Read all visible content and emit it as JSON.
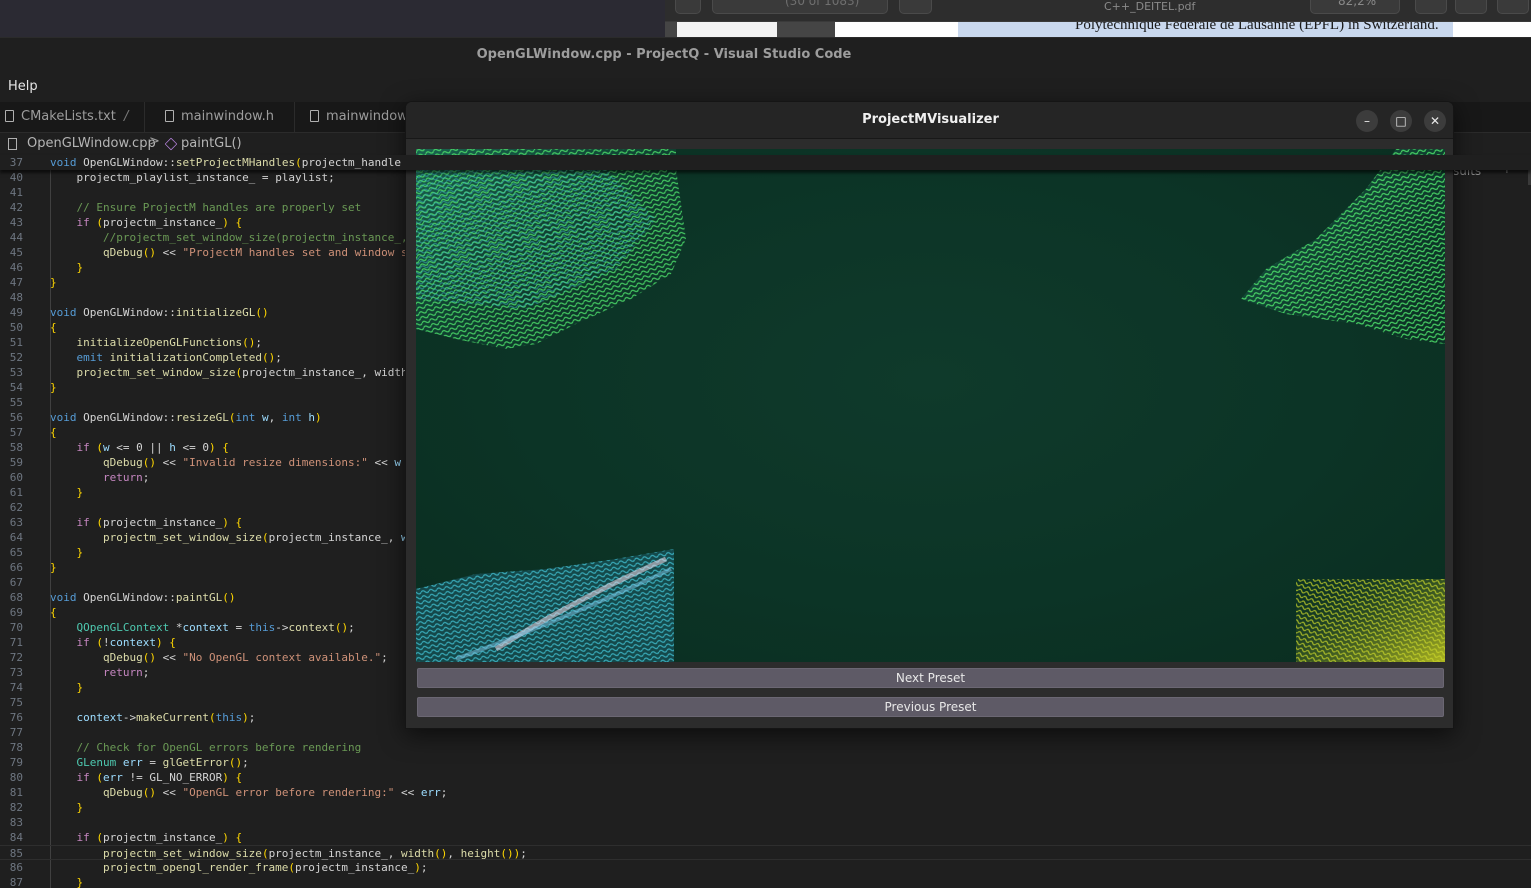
{
  "pdf_viewer": {
    "page_count": "(30 of 1083)",
    "title": "C++_DEITEL.pdf",
    "zoom": "82,2%",
    "visible_text": "Polytechnique Fédérale de Lausanne (EPFL) in Switzerland."
  },
  "vscode": {
    "window_title": "OpenGLWindow.cpp - ProjectQ - Visual Studio Code",
    "menu": {
      "help": "Help"
    },
    "tabs": [
      {
        "label": "CMakeLists.txt",
        "suffix": "/"
      },
      {
        "label": "mainwindow.h"
      },
      {
        "label": "mainwindow.cpp"
      }
    ],
    "breadcrumb": {
      "file": "OpenGLWindow.cpp",
      "separator": ">",
      "symbol": "paintGL()"
    },
    "search_results_label": "sults",
    "lines": [
      {
        "n": "37",
        "t": "void OpenGLWindow::setProjectMHandles(projectm_handle"
      },
      {
        "n": "40",
        "t": "    projectm_playlist_instance_ = playlist;"
      },
      {
        "n": "41",
        "t": ""
      },
      {
        "n": "42",
        "t": "    // Ensure ProjectM handles are properly set"
      },
      {
        "n": "43",
        "t": "    if (projectm_instance_) {"
      },
      {
        "n": "44",
        "t": "        //projectm_set_window_size(projectm_instance_,"
      },
      {
        "n": "45",
        "t": "        qDebug() << \"ProjectM handles set and window s"
      },
      {
        "n": "46",
        "t": "    }"
      },
      {
        "n": "47",
        "t": "}"
      },
      {
        "n": "48",
        "t": ""
      },
      {
        "n": "49",
        "t": "void OpenGLWindow::initializeGL()"
      },
      {
        "n": "50",
        "t": "{"
      },
      {
        "n": "51",
        "t": "    initializeOpenGLFunctions();"
      },
      {
        "n": "52",
        "t": "    emit initializationCompleted();"
      },
      {
        "n": "53",
        "t": "    projectm_set_window_size(projectm_instance_, width"
      },
      {
        "n": "54",
        "t": "}"
      },
      {
        "n": "55",
        "t": ""
      },
      {
        "n": "56",
        "t": "void OpenGLWindow::resizeGL(int w, int h)"
      },
      {
        "n": "57",
        "t": "{"
      },
      {
        "n": "58",
        "t": "    if (w <= 0 || h <= 0) {"
      },
      {
        "n": "59",
        "t": "        qDebug() << \"Invalid resize dimensions:\" << w"
      },
      {
        "n": "60",
        "t": "        return;"
      },
      {
        "n": "61",
        "t": "    }"
      },
      {
        "n": "62",
        "t": ""
      },
      {
        "n": "63",
        "t": "    if (projectm_instance_) {"
      },
      {
        "n": "64",
        "t": "        projectm_set_window_size(projectm_instance_, w"
      },
      {
        "n": "65",
        "t": "    }"
      },
      {
        "n": "66",
        "t": "}"
      },
      {
        "n": "67",
        "t": ""
      },
      {
        "n": "68",
        "t": "void OpenGLWindow::paintGL()"
      },
      {
        "n": "69",
        "t": "{"
      },
      {
        "n": "70",
        "t": "    QOpenGLContext *context = this->context();"
      },
      {
        "n": "71",
        "t": "    if (!context) {"
      },
      {
        "n": "72",
        "t": "        qDebug() << \"No OpenGL context available.\";"
      },
      {
        "n": "73",
        "t": "        return;"
      },
      {
        "n": "74",
        "t": "    }"
      },
      {
        "n": "75",
        "t": ""
      },
      {
        "n": "76",
        "t": "    context->makeCurrent(this);"
      },
      {
        "n": "77",
        "t": ""
      },
      {
        "n": "78",
        "t": "    // Check for OpenGL errors before rendering"
      },
      {
        "n": "79",
        "t": "    GLenum err = glGetError();"
      },
      {
        "n": "80",
        "t": "    if (err != GL_NO_ERROR) {"
      },
      {
        "n": "81",
        "t": "        qDebug() << \"OpenGL error before rendering:\" << err;"
      },
      {
        "n": "82",
        "t": "    }"
      },
      {
        "n": "83",
        "t": ""
      },
      {
        "n": "84",
        "t": "    if (projectm_instance_) {"
      },
      {
        "n": "85",
        "t": "        projectm_set_window_size(projectm_instance_, width(), height());"
      },
      {
        "n": "86",
        "t": "        projectm_opengl_render_frame(projectm_instance_);"
      },
      {
        "n": "87",
        "t": "    }"
      }
    ]
  },
  "visualizer": {
    "title": "ProjectMVisualizer",
    "next_preset": "Next Preset",
    "previous_preset": "Previous Preset",
    "controls": {
      "minimize": "–",
      "maximize": "□",
      "close": "✕"
    }
  },
  "colors": {
    "keyword": "#569cd6",
    "control": "#c586c0",
    "string": "#ce9178",
    "comment": "#6a9955",
    "function": "#dcdcaa",
    "type": "#4ec9b0",
    "variable": "#9cdcfe",
    "brace": "#ffd700",
    "text": "#d4d4d4"
  }
}
